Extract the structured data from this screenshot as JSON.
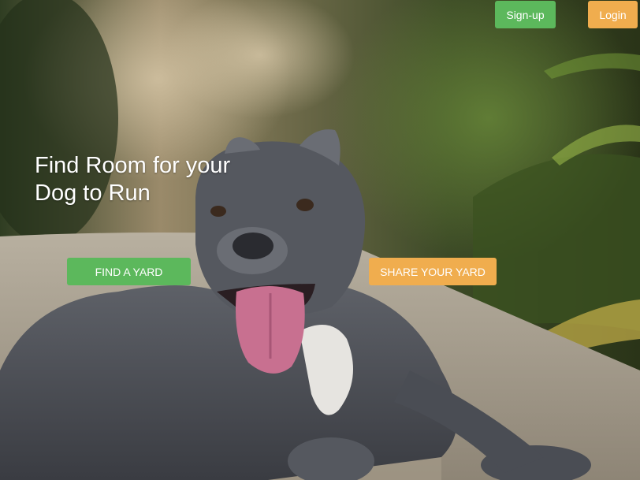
{
  "nav": {
    "signup_label": "Sign-up",
    "login_label": "Login"
  },
  "hero": {
    "headline_line1": "Find Room for your",
    "headline_line2": "Dog to Run",
    "find_button_label": "FIND A YARD",
    "share_button_label": "SHARE YOUR YARD"
  },
  "colors": {
    "green": "#5cb85c",
    "orange": "#f0ad4e"
  }
}
